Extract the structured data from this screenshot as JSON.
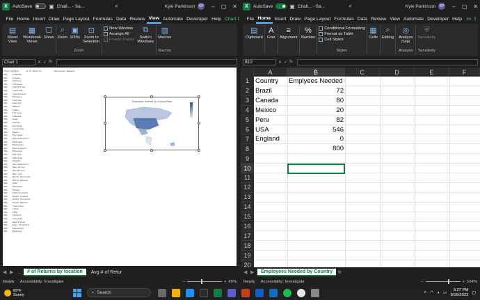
{
  "left_window": {
    "autosave_label": "AutoSave",
    "autosave_state": "Off",
    "title": "Chall... - Sa...",
    "user": "Kyle Parkinson",
    "initials": "KP",
    "tabs": [
      "File",
      "Home",
      "Insert",
      "Draw",
      "Page Layout",
      "Formulas",
      "Data",
      "Review",
      "View",
      "Automate",
      "Developer",
      "Help",
      "Chart Design"
    ],
    "active_tab": "View",
    "ribbon": {
      "sheet_view": "Sheet View",
      "workbook_views": "Workbook Views",
      "show": "Show",
      "zoom": "Zoom",
      "zoom_100": "100%",
      "zoom_selection": "Zoom to Selection",
      "zoom_group": "Zoom",
      "new_window": "New Window",
      "arrange_all": "Arrange All",
      "freeze_panes": "Freeze Panes",
      "switch_windows": "Switch Windows",
      "macros": "Macros",
      "macros_group": "Macros"
    },
    "name_box": "Chart 1",
    "fx": "fx",
    "chart_title": "Employees Needed by Country/State",
    "sheet_tabs": [
      "# of Returns by location",
      "Avg # of Retur"
    ],
    "status": {
      "ready": "Ready",
      "accessibility": "Accessibility: Investigate",
      "zoom": "45%"
    },
    "mini_header": [
      "Country",
      "State",
      "# of Returns",
      "Employees Needed"
    ],
    "mini_rows": [
      [
        "USA",
        "Alabama"
      ],
      [
        "USA",
        "Alaska"
      ],
      [
        "USA",
        "Arizona"
      ],
      [
        "USA",
        "Arkansas"
      ],
      [
        "USA",
        "California"
      ],
      [
        "USA",
        "Colorado"
      ],
      [
        "USA",
        "Connecticut"
      ],
      [
        "USA",
        "Delaware"
      ],
      [
        "USA",
        "Florida"
      ],
      [
        "USA",
        "Georgia"
      ],
      [
        "USA",
        "Hawaii"
      ],
      [
        "USA",
        "Idaho"
      ],
      [
        "USA",
        "Illinois"
      ],
      [
        "USA",
        "Indiana"
      ],
      [
        "USA",
        "Iowa"
      ],
      [
        "USA",
        "Kansas"
      ],
      [
        "USA",
        "Kentucky"
      ],
      [
        "USA",
        "Louisiana"
      ],
      [
        "USA",
        "Maine"
      ],
      [
        "USA",
        "Maryland"
      ],
      [
        "USA",
        "Massachusetts"
      ],
      [
        "USA",
        "Michigan"
      ],
      [
        "USA",
        "Minnesota"
      ],
      [
        "USA",
        "Mississippi"
      ],
      [
        "USA",
        "Missouri"
      ],
      [
        "USA",
        "Montana"
      ],
      [
        "USA",
        "Nebraska"
      ],
      [
        "USA",
        "Nevada"
      ],
      [
        "USA",
        "New Hampshire"
      ],
      [
        "USA",
        "New Jersey"
      ],
      [
        "USA",
        "New Mexico"
      ],
      [
        "USA",
        "New York"
      ],
      [
        "USA",
        "North Carolina"
      ],
      [
        "USA",
        "North Dakota"
      ],
      [
        "USA",
        "Ohio"
      ],
      [
        "USA",
        "Oklahoma"
      ],
      [
        "USA",
        "Oregon"
      ],
      [
        "USA",
        "Pennsylvania"
      ],
      [
        "USA",
        "Rhode Island"
      ],
      [
        "USA",
        "South Carolina"
      ],
      [
        "USA",
        "South Dakota"
      ],
      [
        "USA",
        "Tennessee"
      ],
      [
        "USA",
        "Texas"
      ],
      [
        "USA",
        "Utah"
      ],
      [
        "USA",
        "Vermont"
      ],
      [
        "USA",
        "Virginia"
      ],
      [
        "USA",
        "Washington"
      ],
      [
        "USA",
        "West Virginia"
      ],
      [
        "USA",
        "Wisconsin"
      ],
      [
        "USA",
        "Wyoming"
      ]
    ]
  },
  "right_window": {
    "autosave_label": "AutoSave",
    "autosave_state": "On",
    "title": "Chall... - Sa...",
    "user": "Kyle Parkinson",
    "initials": "KP",
    "tabs": [
      "File",
      "Home",
      "Insert",
      "Draw",
      "Page Layout",
      "Formulas",
      "Data",
      "Review",
      "View",
      "Automate",
      "Developer",
      "Help"
    ],
    "active_tab": "Home",
    "ribbon": {
      "clipboard": "Clipboard",
      "font": "Font",
      "alignment": "Alignment",
      "number": "Number",
      "conditional_formatting": "Conditional Formatting",
      "format_as_table": "Format as Table",
      "cell_styles": "Cell Styles",
      "styles_group": "Styles",
      "cells": "Cells",
      "editing": "Editing",
      "analyze_data": "Analyze Data",
      "analysis_group": "Analysis",
      "sensitivity": "Sensitivity",
      "sensitivity_group": "Sensitivity"
    },
    "name_box": "B10",
    "fx": "fx",
    "columns": [
      "A",
      "B",
      "C",
      "D",
      "E",
      "F"
    ],
    "rows": [
      "1",
      "2",
      "3",
      "4",
      "5",
      "6",
      "7",
      "8",
      "9",
      "10",
      "11",
      "12",
      "13",
      "14",
      "15",
      "16",
      "17",
      "18",
      "19",
      "20"
    ],
    "table": {
      "header": [
        "Country",
        "Emplyees Needed"
      ],
      "rows": [
        [
          "Brazil",
          "72"
        ],
        [
          "Canada",
          "80"
        ],
        [
          "Mexico",
          "20"
        ],
        [
          "Peru",
          "82"
        ],
        [
          "USA",
          "546"
        ],
        [
          "England",
          "0"
        ]
      ],
      "total": "800"
    },
    "sheet_tab": "Employees Needed by Country",
    "status": {
      "ready": "Ready",
      "accessibility": "Accessibility: Investigate",
      "zoom": "164%"
    }
  },
  "taskbar": {
    "temperature": "83°F",
    "condition": "Sunny",
    "search_placeholder": "Search",
    "time": "3:27 PM",
    "date": "9/16/2023"
  },
  "colors": {
    "excel_green": "#107c41",
    "dark_bg": "#1f1f1f",
    "ribbon_bg": "#2a2a2a",
    "accent_blue": "#3ea6ff"
  }
}
